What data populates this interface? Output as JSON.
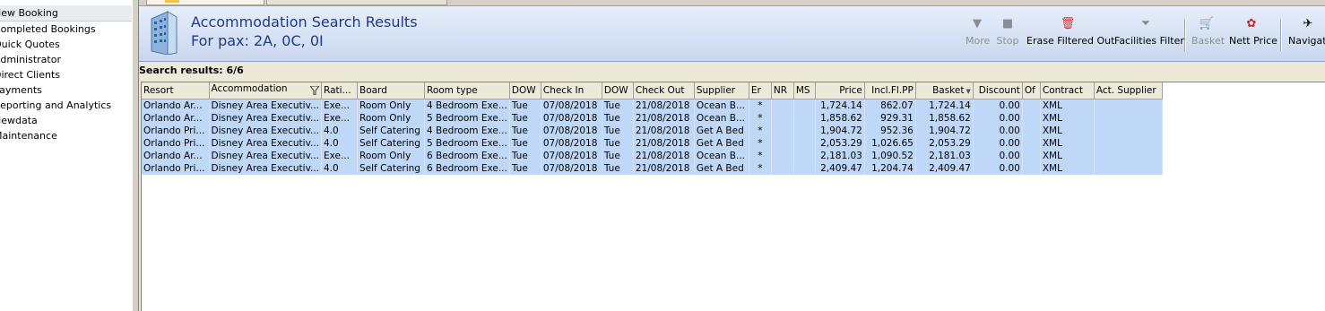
{
  "nav": {
    "items": [
      {
        "label": "New Booking"
      },
      {
        "label": "Completed Bookings"
      },
      {
        "label": "Quick Quotes"
      },
      {
        "label": "Administrator"
      },
      {
        "label": "Direct Clients"
      },
      {
        "label": "Payments"
      },
      {
        "label": "Reporting and Analytics"
      },
      {
        "label": "Newdata"
      },
      {
        "label": "Maintenance"
      }
    ]
  },
  "header": {
    "title": "Accommodation Search Results",
    "subtitle": "For pax: 2A, 0C, 0I"
  },
  "toolbar": {
    "more": "More",
    "stop": "Stop",
    "erase": "Erase Filtered Out",
    "facilities": "Facilities Filter",
    "basket": "Basket",
    "nett_price": "Nett Price",
    "navigate": "Navigate"
  },
  "summary": "Search results: 6/6",
  "grid": {
    "columns": [
      "Resort",
      "Accommodation",
      "Rati...",
      "Board",
      "Room type",
      "DOW",
      "Check In",
      "DOW",
      "Check Out",
      "Supplier",
      "Er",
      "NR",
      "MS",
      "Price",
      "Incl.Fl.PP",
      "Basket",
      "Discount",
      "Of",
      "Contract",
      "Act. Supplier"
    ],
    "rows": [
      [
        "Orlando Ar...",
        "Disney Area Executiv...",
        "Exe...",
        "Room Only",
        "4 Bedroom Exe...",
        "Tue",
        "07/08/2018",
        "Tue",
        "21/08/2018",
        "Ocean B...",
        "*",
        "",
        "",
        "1,724.14",
        "862.07",
        "1,724.14",
        "0.00",
        "",
        "XML",
        ""
      ],
      [
        "Orlando Ar...",
        "Disney Area Executiv...",
        "Exe...",
        "Room Only",
        "5 Bedroom Exe...",
        "Tue",
        "07/08/2018",
        "Tue",
        "21/08/2018",
        "Ocean B...",
        "*",
        "",
        "",
        "1,858.62",
        "929.31",
        "1,858.62",
        "0.00",
        "",
        "XML",
        ""
      ],
      [
        "Orlando Pri...",
        "Disney Area Executiv...",
        "4.0",
        "Self Catering",
        "4 Bedroom Exe...",
        "Tue",
        "07/08/2018",
        "Tue",
        "21/08/2018",
        "Get A Bed",
        "*",
        "",
        "",
        "1,904.72",
        "952.36",
        "1,904.72",
        "0.00",
        "",
        "XML",
        ""
      ],
      [
        "Orlando Pri...",
        "Disney Area Executiv...",
        "4.0",
        "Self Catering",
        "5 Bedroom Exe...",
        "Tue",
        "07/08/2018",
        "Tue",
        "21/08/2018",
        "Get A Bed",
        "*",
        "",
        "",
        "2,053.29",
        "1,026.65",
        "2,053.29",
        "0.00",
        "",
        "XML",
        ""
      ],
      [
        "Orlando Ar...",
        "Disney Area Executiv...",
        "Exe...",
        "Room Only",
        "6 Bedroom Exe...",
        "Tue",
        "07/08/2018",
        "Tue",
        "21/08/2018",
        "Ocean B...",
        "*",
        "",
        "",
        "2,181.03",
        "1,090.52",
        "2,181.03",
        "0.00",
        "",
        "XML",
        ""
      ],
      [
        "Orlando Pri...",
        "Disney Area Executiv...",
        "4.0",
        "Self Catering",
        "6 Bedroom Exe...",
        "Tue",
        "07/08/2018",
        "Tue",
        "21/08/2018",
        "Get A Bed",
        "*",
        "",
        "",
        "2,409.47",
        "1,204.74",
        "2,409.47",
        "0.00",
        "",
        "XML",
        ""
      ]
    ]
  },
  "colors": {
    "title": "#1f3a8a",
    "row_highlight": "#bfd8f7",
    "header_gradient_top": "#e7eefb",
    "header_gradient_bottom": "#c9d7ee"
  }
}
